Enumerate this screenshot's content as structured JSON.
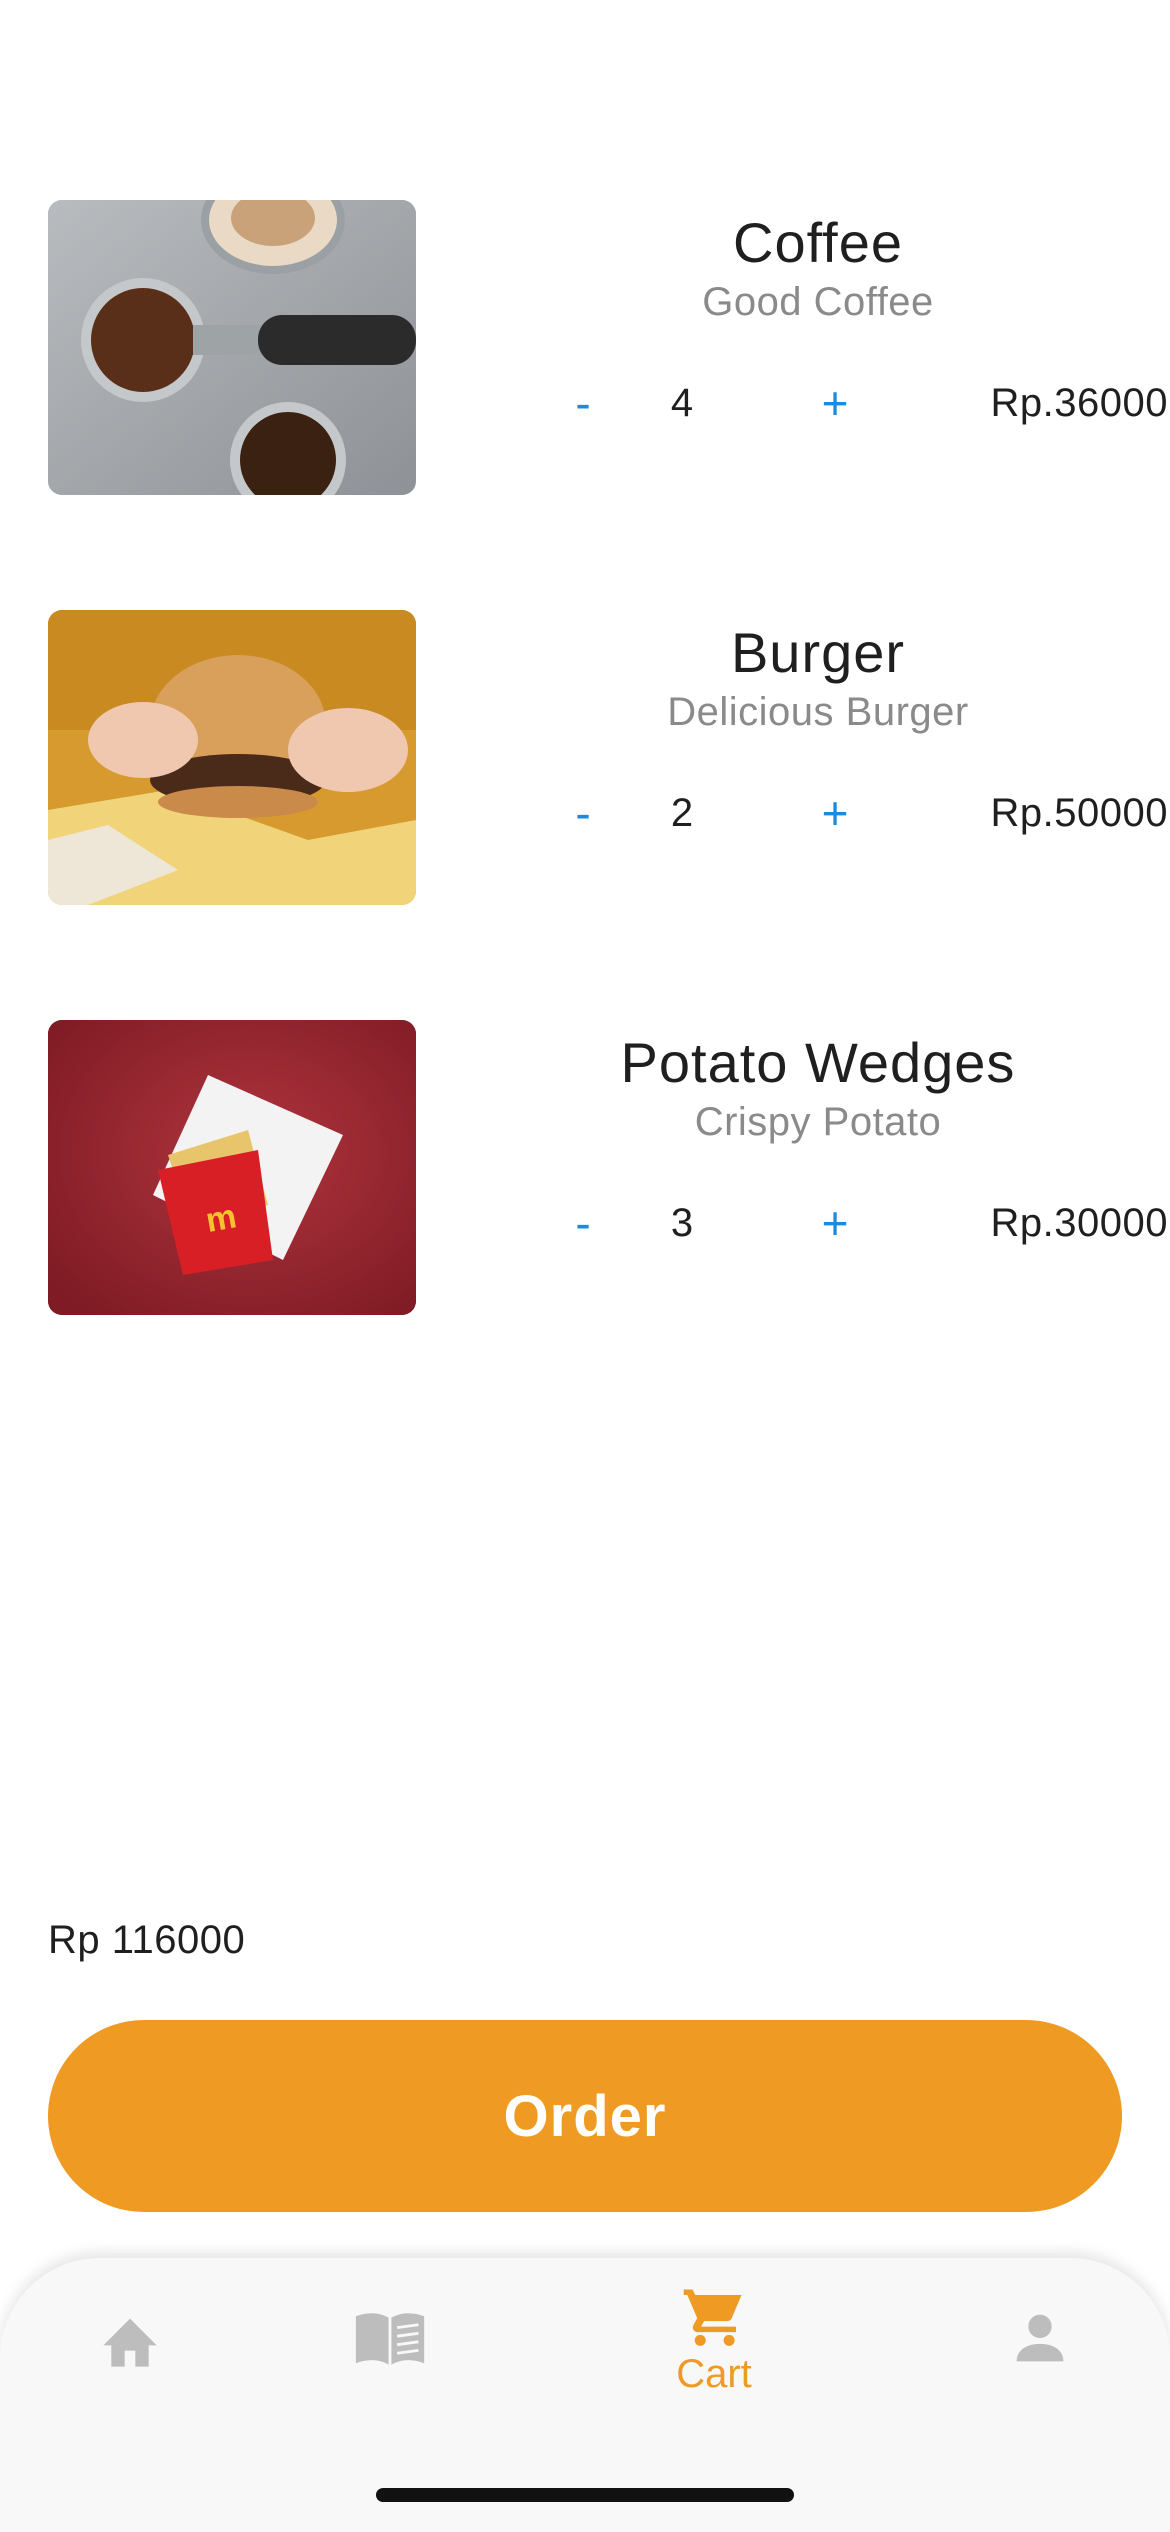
{
  "cart": {
    "items": [
      {
        "title": "Coffee",
        "subtitle": "Good Coffee",
        "quantity": "4",
        "price": "Rp.36000",
        "minus_label": "-",
        "plus_label": "+"
      },
      {
        "title": "Burger",
        "subtitle": "Delicious Burger",
        "quantity": "2",
        "price": "Rp.50000",
        "minus_label": "-",
        "plus_label": "+"
      },
      {
        "title": "Potato Wedges",
        "subtitle": "Crispy Potato",
        "quantity": "3",
        "price": "Rp.30000",
        "minus_label": "-",
        "plus_label": "+"
      }
    ],
    "total": "Rp 116000"
  },
  "order_button": {
    "label": "Order"
  },
  "nav": {
    "items": [
      {
        "icon": "home-icon",
        "active": false
      },
      {
        "icon": "book-icon",
        "active": false
      },
      {
        "icon": "cart-icon",
        "label": "Cart",
        "active": true
      },
      {
        "icon": "person-icon",
        "active": false
      }
    ]
  },
  "colors": {
    "accent": "#ef9a23",
    "qty_button": "#1a8be0",
    "inactive_icon": "#bdbdbd"
  }
}
